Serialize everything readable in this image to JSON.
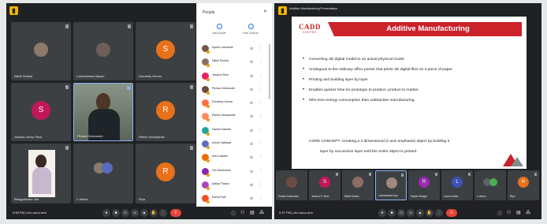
{
  "left_window": {
    "tiles": [
      {
        "name": "Nikhil Shukla",
        "kind": "photo"
      },
      {
        "name": "Lokhandwani Ayush",
        "kind": "photo"
      },
      {
        "name": "Dondeep Kumar",
        "kind": "avatar",
        "letter": "S",
        "color": "#e8711a"
      },
      {
        "name": "Jessica Jenny Silva",
        "kind": "avatar",
        "letter": "S",
        "color": "#c2185b"
      },
      {
        "name": "Pinhas Deshmukh",
        "kind": "video"
      },
      {
        "name": "Ritesh Deshpande",
        "kind": "avatar",
        "letter": "R",
        "color": "#e8711a"
      },
      {
        "name": "Bhagyashree Jha",
        "kind": "video"
      },
      {
        "name": "2 others",
        "kind": "group"
      },
      {
        "name": "Riya",
        "kind": "avatar",
        "letter": "R",
        "color": "#e8711a"
      }
    ],
    "people_panel": {
      "title": "People",
      "close": "✕",
      "actions": [
        {
          "label": "Add people",
          "icon": "add-person-icon"
        },
        {
          "label": "Host controls",
          "icon": "host-controls-icon"
        }
      ],
      "participants": [
        {
          "name": "Ayush Lokhande",
          "color": "#795548"
        },
        {
          "name": "Nikhil Shukla",
          "color": "#8d6e63"
        },
        {
          "name": "Jessica Silva",
          "color": "#e91e63"
        },
        {
          "name": "Pinhas Deshmukh",
          "color": "#6d4c41"
        },
        {
          "name": "Dondeep Kumar",
          "color": "#ff7043"
        },
        {
          "name": "Ritesh Deshpande",
          "color": "#ff8a65"
        },
        {
          "name": "Sanika Sawant",
          "color": "#26a69a"
        },
        {
          "name": "Kunal Gaikwad",
          "color": "#5c6bc0"
        },
        {
          "name": "Kirti Kulkarni",
          "color": "#ef6c00"
        },
        {
          "name": "Om Deshmukh",
          "color": "#8e24aa"
        },
        {
          "name": "Aditya Thakur",
          "color": "#ab47bc"
        },
        {
          "name": "Rahul Patil",
          "color": "#f4511e"
        },
        {
          "name": "Abhishek Deshmukh",
          "color": "#3949ab"
        }
      ]
    },
    "bottom_bar": {
      "time": "9:58 PM | ctm-uduu-anh",
      "controls": [
        "mic-icon",
        "camera-icon",
        "captions-icon",
        "raise-hand-icon",
        "present-icon",
        "more-icon",
        "end-call-icon"
      ]
    }
  },
  "right_window": {
    "title": "Additive Manufacturing Presentation",
    "slide": {
      "logo_main": "CADD",
      "logo_sub": "CENTRE",
      "title": "Additive Manufacturing",
      "bullets": [
        "Converting 3D digital model to an actual physical model.",
        "Analogous to the ordinary office printer that prints 3D digital files on a piece of paper.",
        "Printing and building layer by layer",
        "Enables quicker time for prototype to product- product to market.",
        "50% less energy consumption than subtractive manufacturing."
      ],
      "core_line1": "CORE CONCEPT: Creating a 3 dimensional (z axis emphasis) object by building it",
      "core_line2": "layer by successive layer until the entire object is printed."
    },
    "strip": [
      {
        "name": "Pinhas Deshmukh",
        "kind": "photo"
      },
      {
        "name": "Jessica S. Silva",
        "kind": "avatar",
        "letter": "S",
        "color": "#c2185b"
      },
      {
        "name": "Nikhil Shukla",
        "kind": "photo"
      },
      {
        "name": "Lokhandwani Ayu",
        "kind": "photo"
      },
      {
        "name": "Rajesh Bhagat",
        "kind": "avatar",
        "letter": "R",
        "color": "#9c27b0"
      },
      {
        "name": "Laxmi Kulkar",
        "kind": "avatar",
        "letter": "L",
        "color": "#3f51b5"
      },
      {
        "name": "2 others",
        "kind": "group"
      },
      {
        "name": "Riya",
        "kind": "avatar",
        "letter": "R",
        "color": "#e8711a"
      }
    ],
    "bottom_bar": {
      "time": "9:37 PM | ctm-uduu-anh"
    }
  }
}
